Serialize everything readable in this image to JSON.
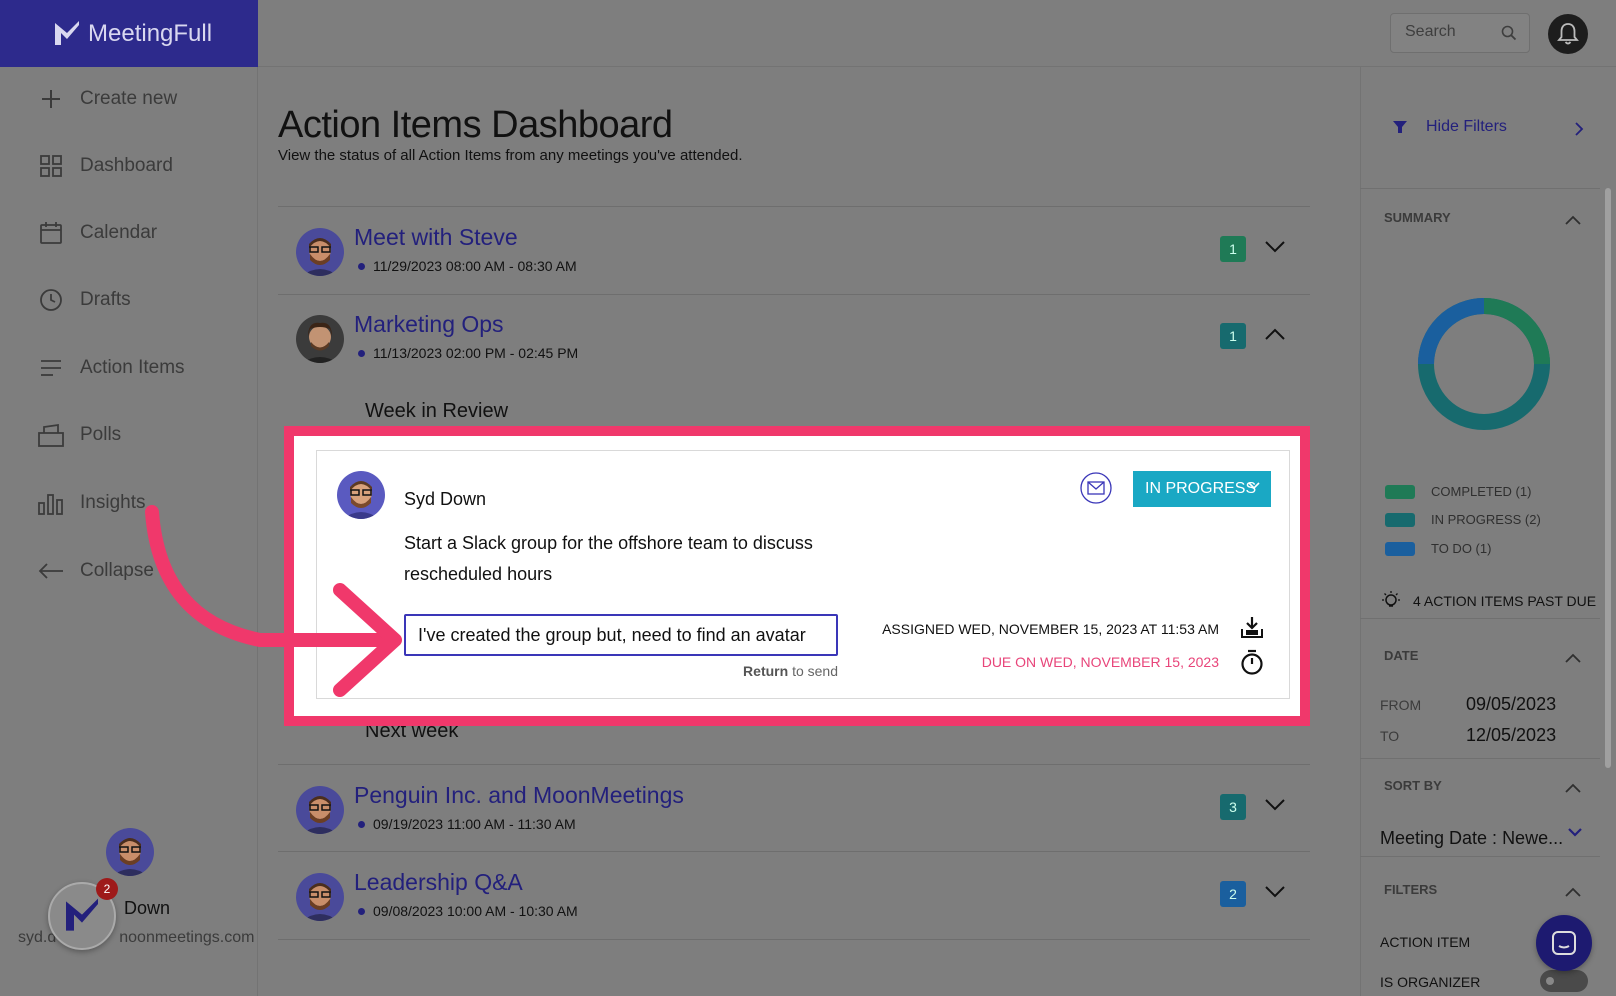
{
  "app": {
    "name": "MeetingFull"
  },
  "header": {
    "search_placeholder": "Search"
  },
  "sidebar": {
    "items": [
      {
        "label": "Create new",
        "icon": "plus-icon"
      },
      {
        "label": "Dashboard",
        "icon": "grid-icon"
      },
      {
        "label": "Calendar",
        "icon": "calendar-icon"
      },
      {
        "label": "Drafts",
        "icon": "clock-icon"
      },
      {
        "label": "Action Items",
        "icon": "list-icon"
      },
      {
        "label": "Polls",
        "icon": "polls-icon"
      },
      {
        "label": "Insights",
        "icon": "bar-chart-icon"
      },
      {
        "label": "Collapse",
        "icon": "arrow-left-icon"
      }
    ],
    "user": {
      "name": "Down",
      "email": "syd.d",
      "email_tail": "noonmeetings.com",
      "notification_count": "2"
    }
  },
  "main": {
    "title": "Action Items Dashboard",
    "subtitle": "View the status of all Action Items from any meetings you've attended.",
    "meetings": [
      {
        "title": "Meet with Steve",
        "time": "11/29/2023 08:00 AM - 08:30 AM",
        "count": "1",
        "badge_color": "#1f7a56"
      },
      {
        "title": "Marketing Ops",
        "time": "11/13/2023 02:00 PM - 02:45 PM",
        "count": "1",
        "badge_color": "#176a6e"
      },
      {
        "title": "Penguin Inc. and MoonMeetings",
        "time": "09/19/2023 11:00 AM - 11:30 AM",
        "count": "3",
        "badge_color": "#176a6e"
      },
      {
        "title": "Leadership Q&A",
        "time": "09/08/2023 10:00 AM - 10:30 AM",
        "count": "2",
        "badge_color": "#1a5f9e"
      }
    ],
    "sections": {
      "week_in_review": "Week in Review",
      "next_week": "Next week"
    },
    "action_item": {
      "owner": "Syd Down",
      "description": "Start a Slack group for the offshore team to discuss rescheduled hours",
      "status": "IN PROGRESS",
      "reply_value": "I've created the group but, need to find an avatar",
      "reply_hint_key": "Return",
      "reply_hint_rest": "to send",
      "assigned": "ASSIGNED WED, NOVEMBER 15, 2023 AT 11:53 AM",
      "due": "DUE ON WED, NOVEMBER 15, 2023"
    }
  },
  "right_panel": {
    "hide_filters": "Hide Filters",
    "summary_label": "SUMMARY",
    "legend": [
      {
        "label": "COMPLETED (1)",
        "color": "#1f7a56",
        "value": 1
      },
      {
        "label": "IN PROGRESS (2)",
        "color": "#176a6e",
        "value": 2
      },
      {
        "label": "TO DO (1)",
        "color": "#1a5f9e",
        "value": 1
      }
    ],
    "past_due": "4 ACTION ITEMS PAST DUE",
    "date_label": "DATE",
    "from_label": "FROM",
    "from_value": "09/05/2023",
    "to_label": "TO",
    "to_value": "12/05/2023",
    "sort_label": "SORT BY",
    "sort_value": "Meeting Date : Newe...",
    "filters_label": "FILTERS",
    "filter_items": [
      "ACTION ITEM",
      "IS ORGANIZER"
    ]
  },
  "colors": {
    "accent": "#23207c",
    "highlight": "#f0386b",
    "status": "#1aa8c4",
    "due": "#e8457a"
  }
}
